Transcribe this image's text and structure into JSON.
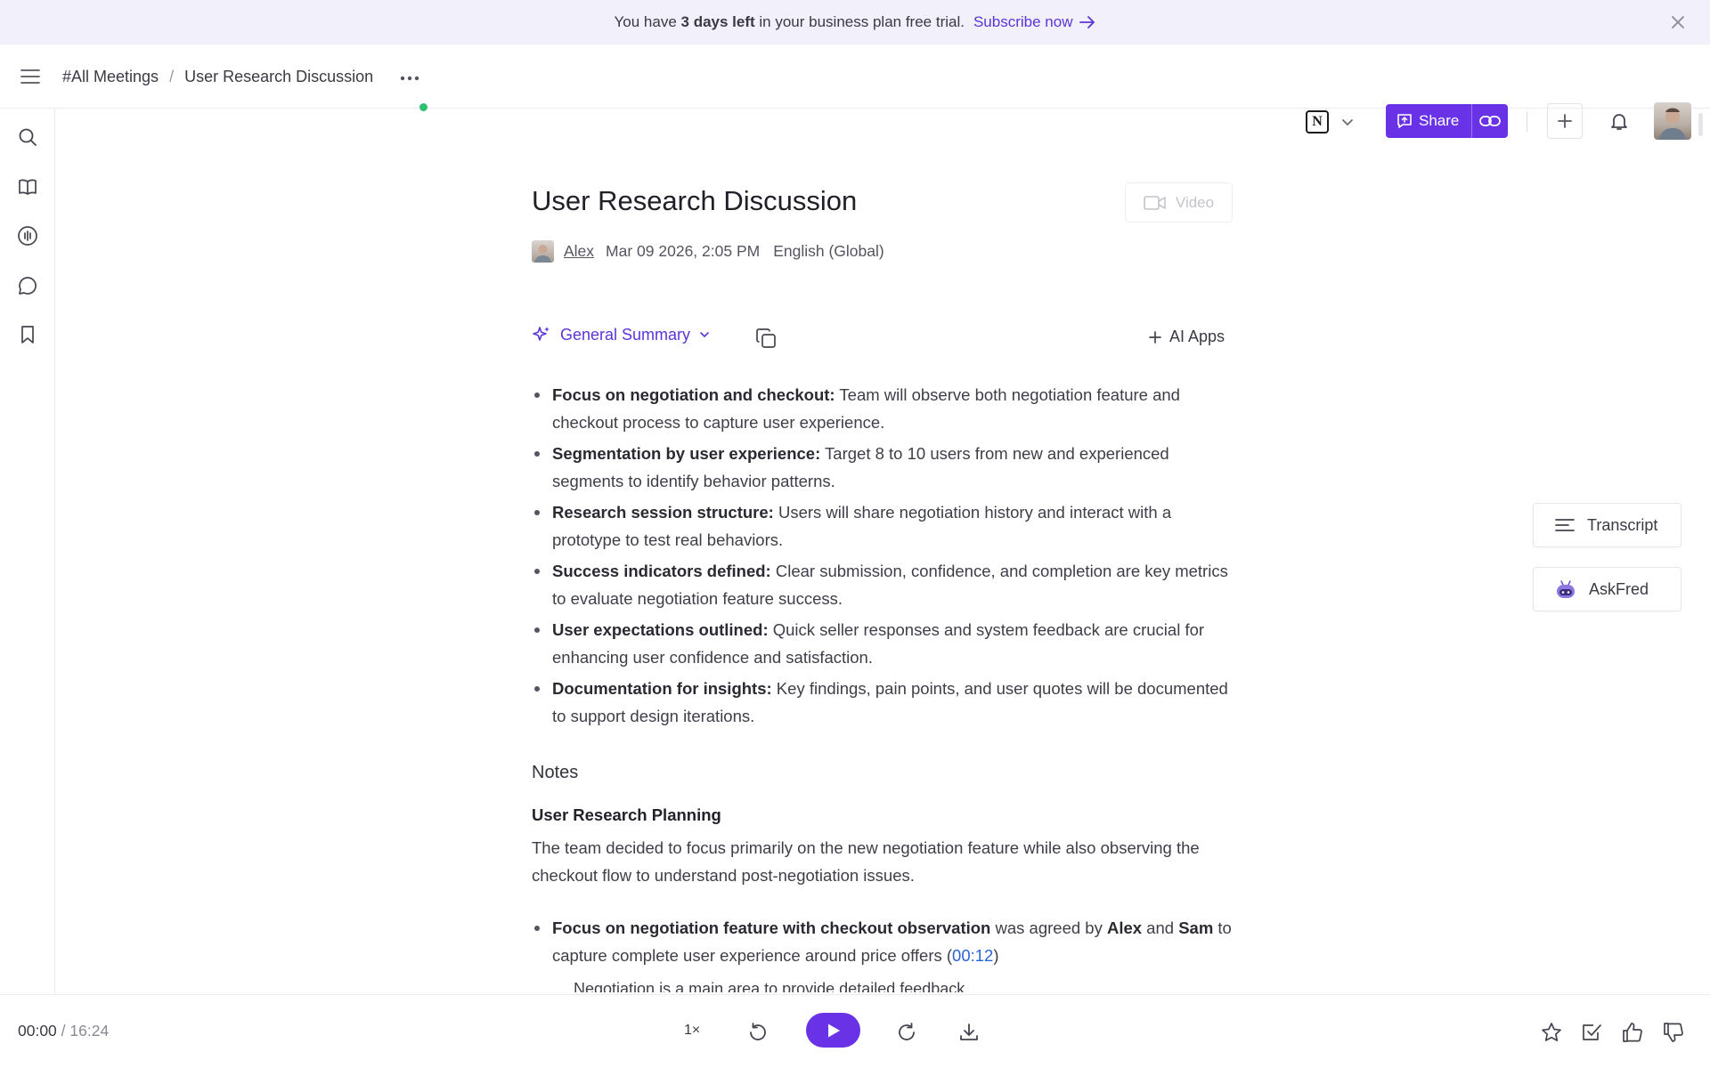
{
  "banner": {
    "text_before": "You have ",
    "days_bold": "3 days left",
    "text_after": " in your business plan free trial.",
    "subscribe_label": "Subscribe now"
  },
  "header": {
    "breadcrumb_root": "#All Meetings",
    "breadcrumb_separator": "/",
    "breadcrumb_current": "User Research Discussion",
    "integration_letter": "N",
    "share_label": "Share"
  },
  "meeting": {
    "title": "User Research Discussion",
    "video_label": "Video",
    "author": "Alex",
    "date": "Mar 09 2026, 2:05 PM",
    "language": "English (Global)"
  },
  "summary": {
    "dropdown_label": "General Summary",
    "ai_apps_label": "AI Apps",
    "points": [
      {
        "bold": "Focus on negotiation and checkout:",
        "text": " Team will observe both negotiation feature and checkout process to capture user experience."
      },
      {
        "bold": "Segmentation by user experience:",
        "text": " Target 8 to 10 users from new and experienced segments to identify behavior patterns."
      },
      {
        "bold": "Research session structure:",
        "text": " Users will share negotiation history and interact with a prototype to test real behaviors."
      },
      {
        "bold": "Success indicators defined:",
        "text": " Clear submission, confidence, and completion are key metrics to evaluate negotiation feature success."
      },
      {
        "bold": "User expectations outlined:",
        "text": " Quick seller responses and system feedback are crucial for enhancing user confidence and satisfaction."
      },
      {
        "bold": "Documentation for insights:",
        "text": " Key findings, pain points, and user quotes will be documented to support design iterations."
      }
    ]
  },
  "notes": {
    "heading": "Notes",
    "subheading": "User Research Planning",
    "paragraph": "The team decided to focus primarily on the new negotiation feature while also observing the checkout flow to understand post-negotiation issues.",
    "item": {
      "bold": "Focus on negotiation feature with checkout observation",
      "text1": " was agreed by ",
      "name1": "Alex",
      "text2": " and ",
      "name2": "Sam",
      "text3": " to capture complete user experience around price offers (",
      "timestamp": "00:12",
      "text4": ")"
    },
    "cut_line": "Negotiation is a main area to provide detailed feedback"
  },
  "side_panel": {
    "transcript_label": "Transcript",
    "askfred_label": "AskFred"
  },
  "player": {
    "current_time": "00:00",
    "separator": " / ",
    "total_time": "16:24",
    "speed": "1×"
  },
  "colors": {
    "accent": "#6a32e6",
    "link": "#2b63d9",
    "banner_bg": "#f1f0fb",
    "status_dot": "#2fbf71"
  },
  "icons": {
    "sidebar": [
      "search-icon",
      "book-icon",
      "audio-wave-icon",
      "chat-icon",
      "bookmark-icon"
    ],
    "player": [
      "rewind-icon",
      "play-icon",
      "forward-icon",
      "download-icon"
    ],
    "feedback": [
      "star-icon",
      "checkbox-icon",
      "thumbs-up-icon",
      "thumbs-down-icon"
    ]
  }
}
